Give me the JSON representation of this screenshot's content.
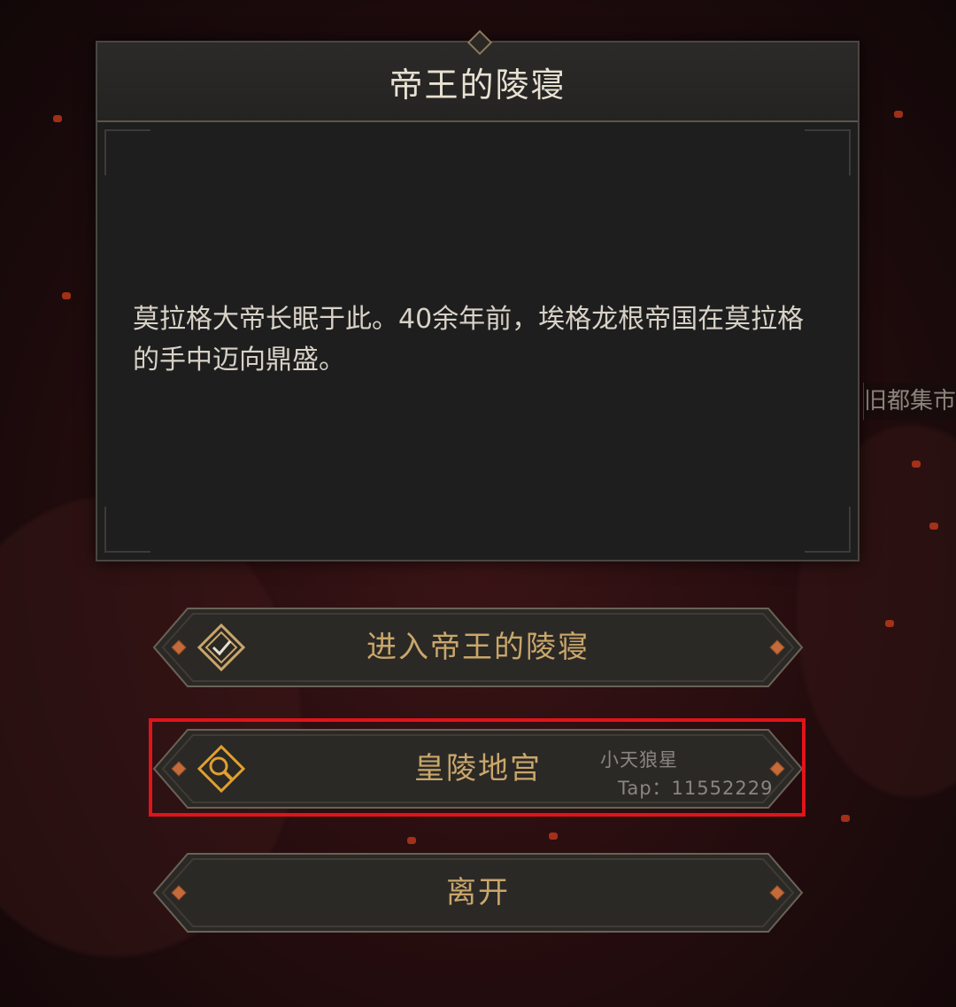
{
  "map": {
    "location_label": "旧都集市遗址"
  },
  "dialog": {
    "title": "帝王的陵寝",
    "description": "莫拉格大帝长眠于此。40余年前，埃格龙根帝国在莫拉格的手中迈向鼎盛。"
  },
  "actions": [
    {
      "label": "进入帝王的陵寝",
      "icon": "check-badge-icon"
    },
    {
      "label": "皇陵地宫",
      "icon": "magnifier-icon"
    },
    {
      "label": "离开",
      "icon": ""
    }
  ],
  "watermark": {
    "name": "小天狼星",
    "tap": "Tap：11552229"
  },
  "colors": {
    "button_text": "#c9a66a",
    "icon_gold": "#e0a030",
    "highlight": "#e0141a"
  }
}
